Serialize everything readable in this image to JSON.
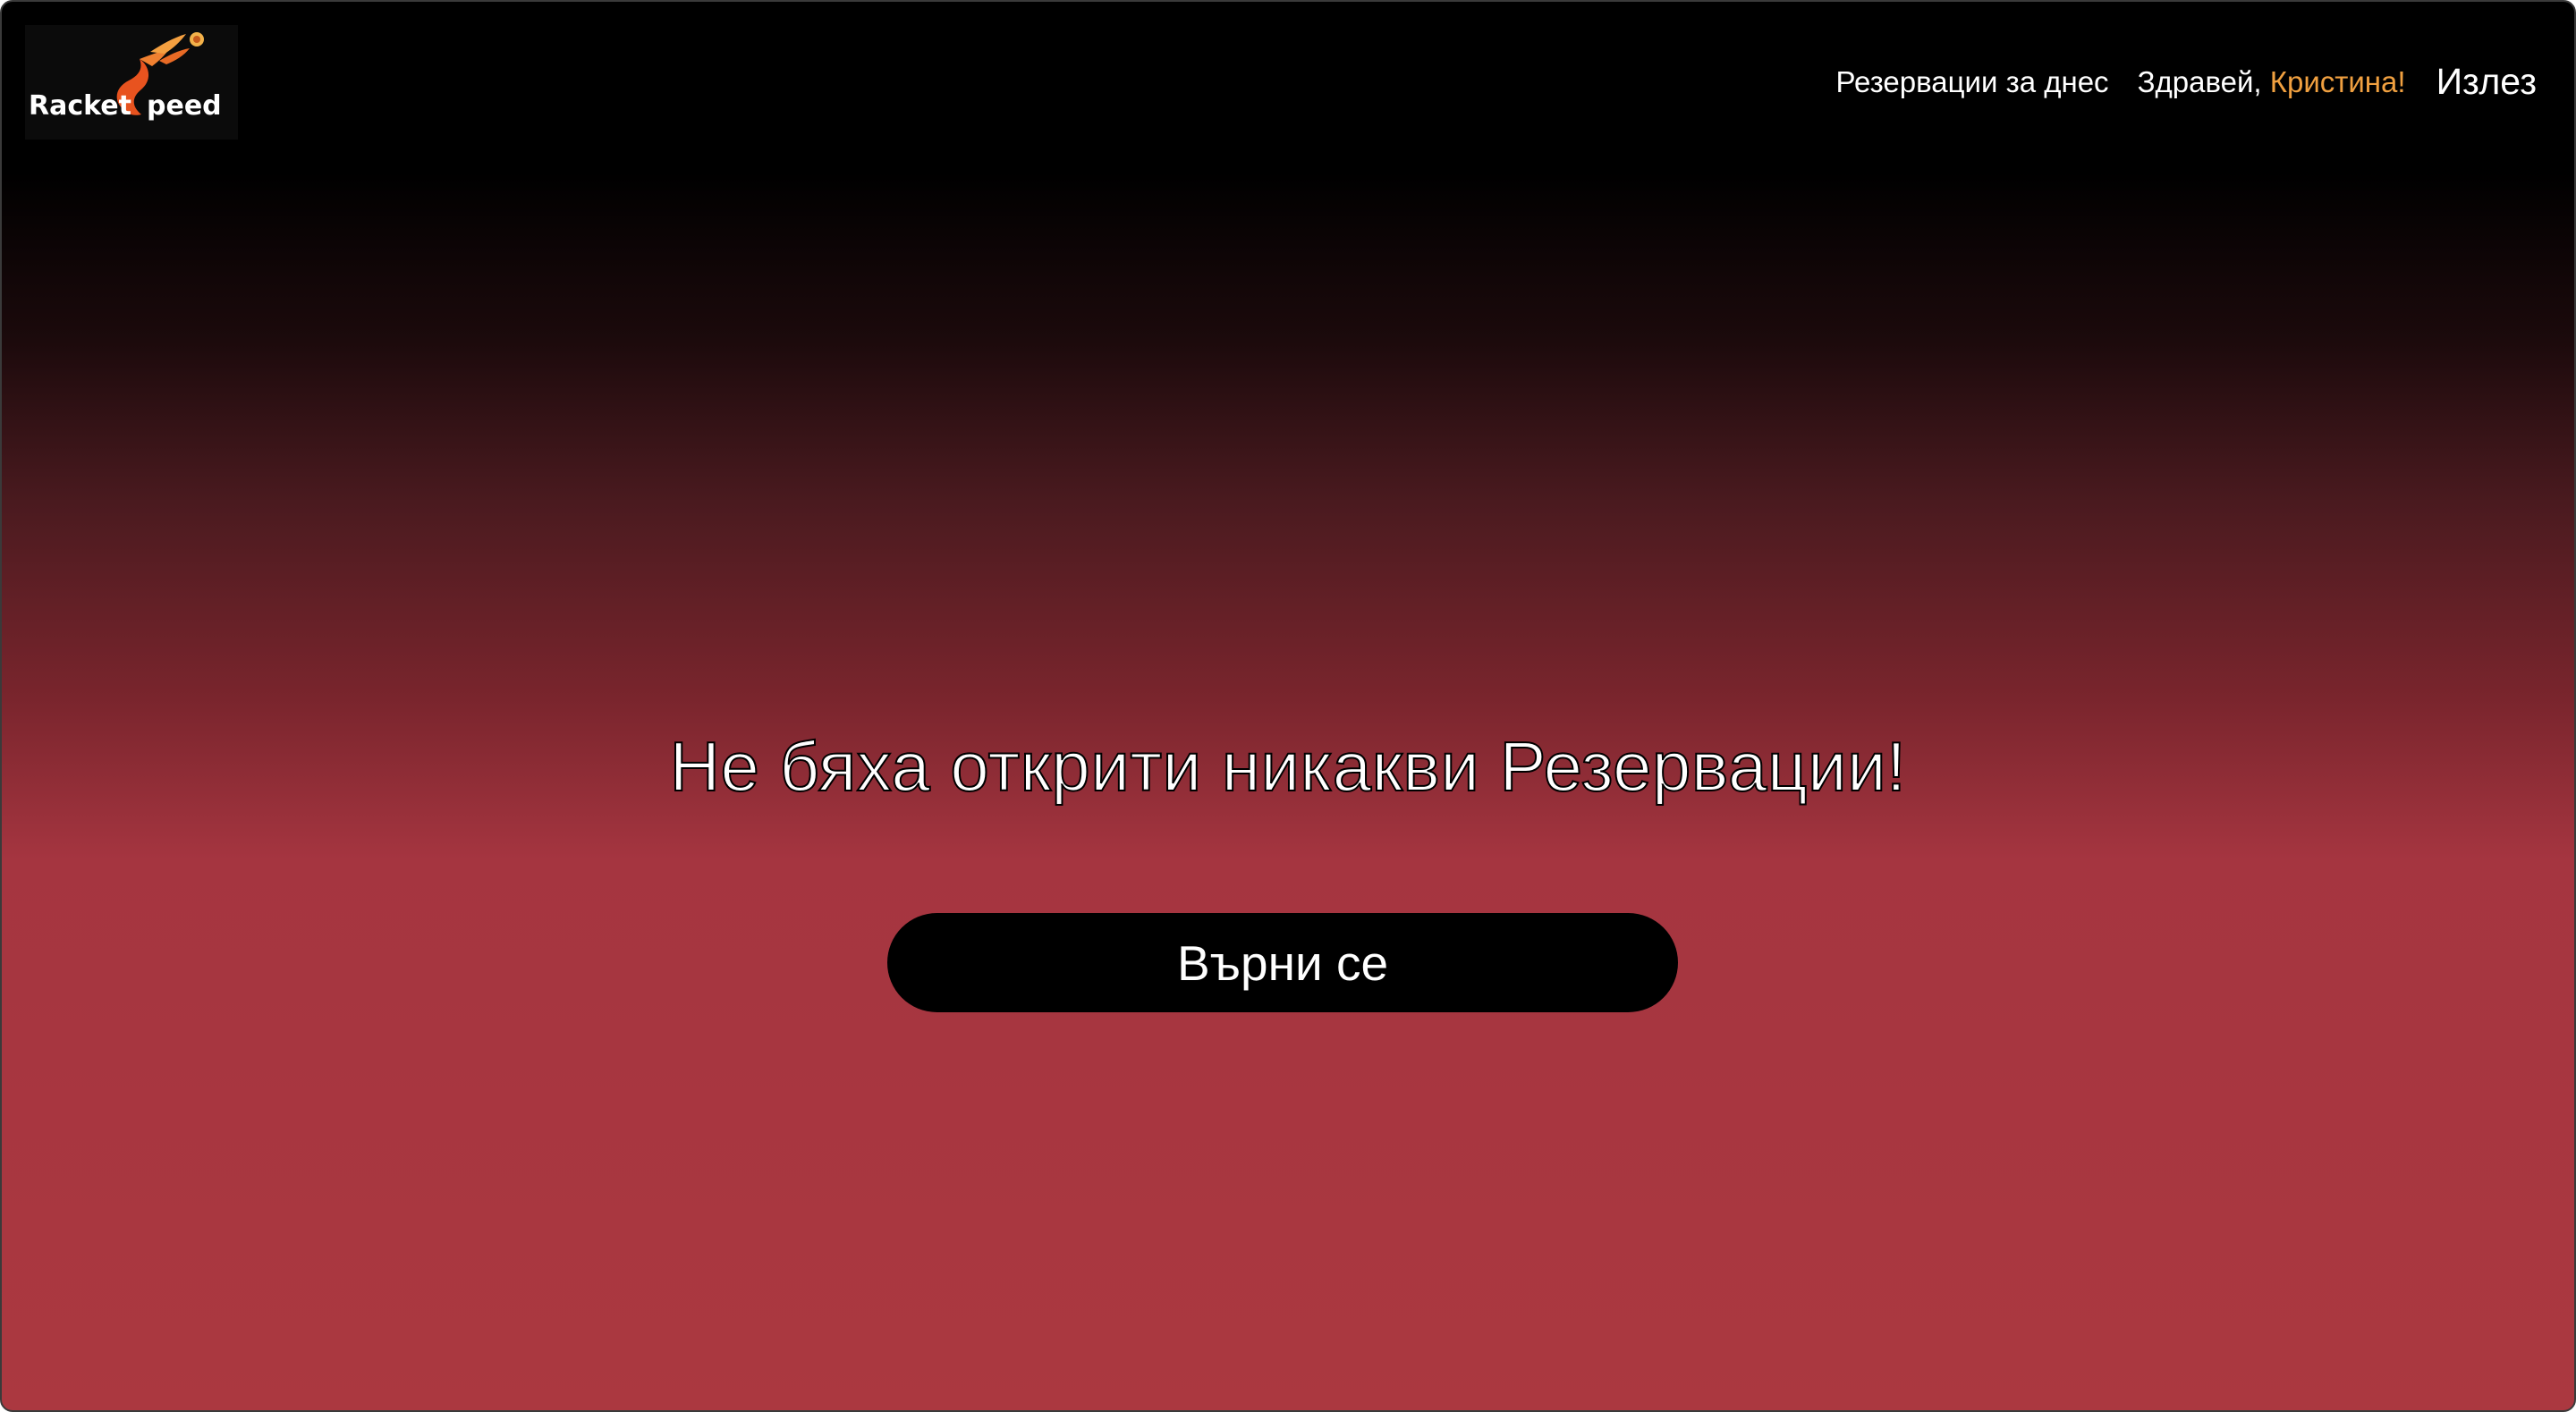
{
  "header": {
    "logo": {
      "text_left": "Racket",
      "text_s": "S",
      "text_right": "peed",
      "icon": "shuttlecock-flame-icon"
    },
    "nav": {
      "reservations_today": "Резервации за днес",
      "greeting_prefix": "Здравей, ",
      "user_name": "Кристина!",
      "logout": "Излез"
    }
  },
  "main": {
    "message": "Не бяха открити никакви Резервации!",
    "back_button": "Върни се"
  },
  "colors": {
    "accent": "#f0a040",
    "button_bg": "#000000",
    "gradient_top": "#000000",
    "gradient_bottom": "#ab3840",
    "logo_orange": "#e8531f"
  }
}
